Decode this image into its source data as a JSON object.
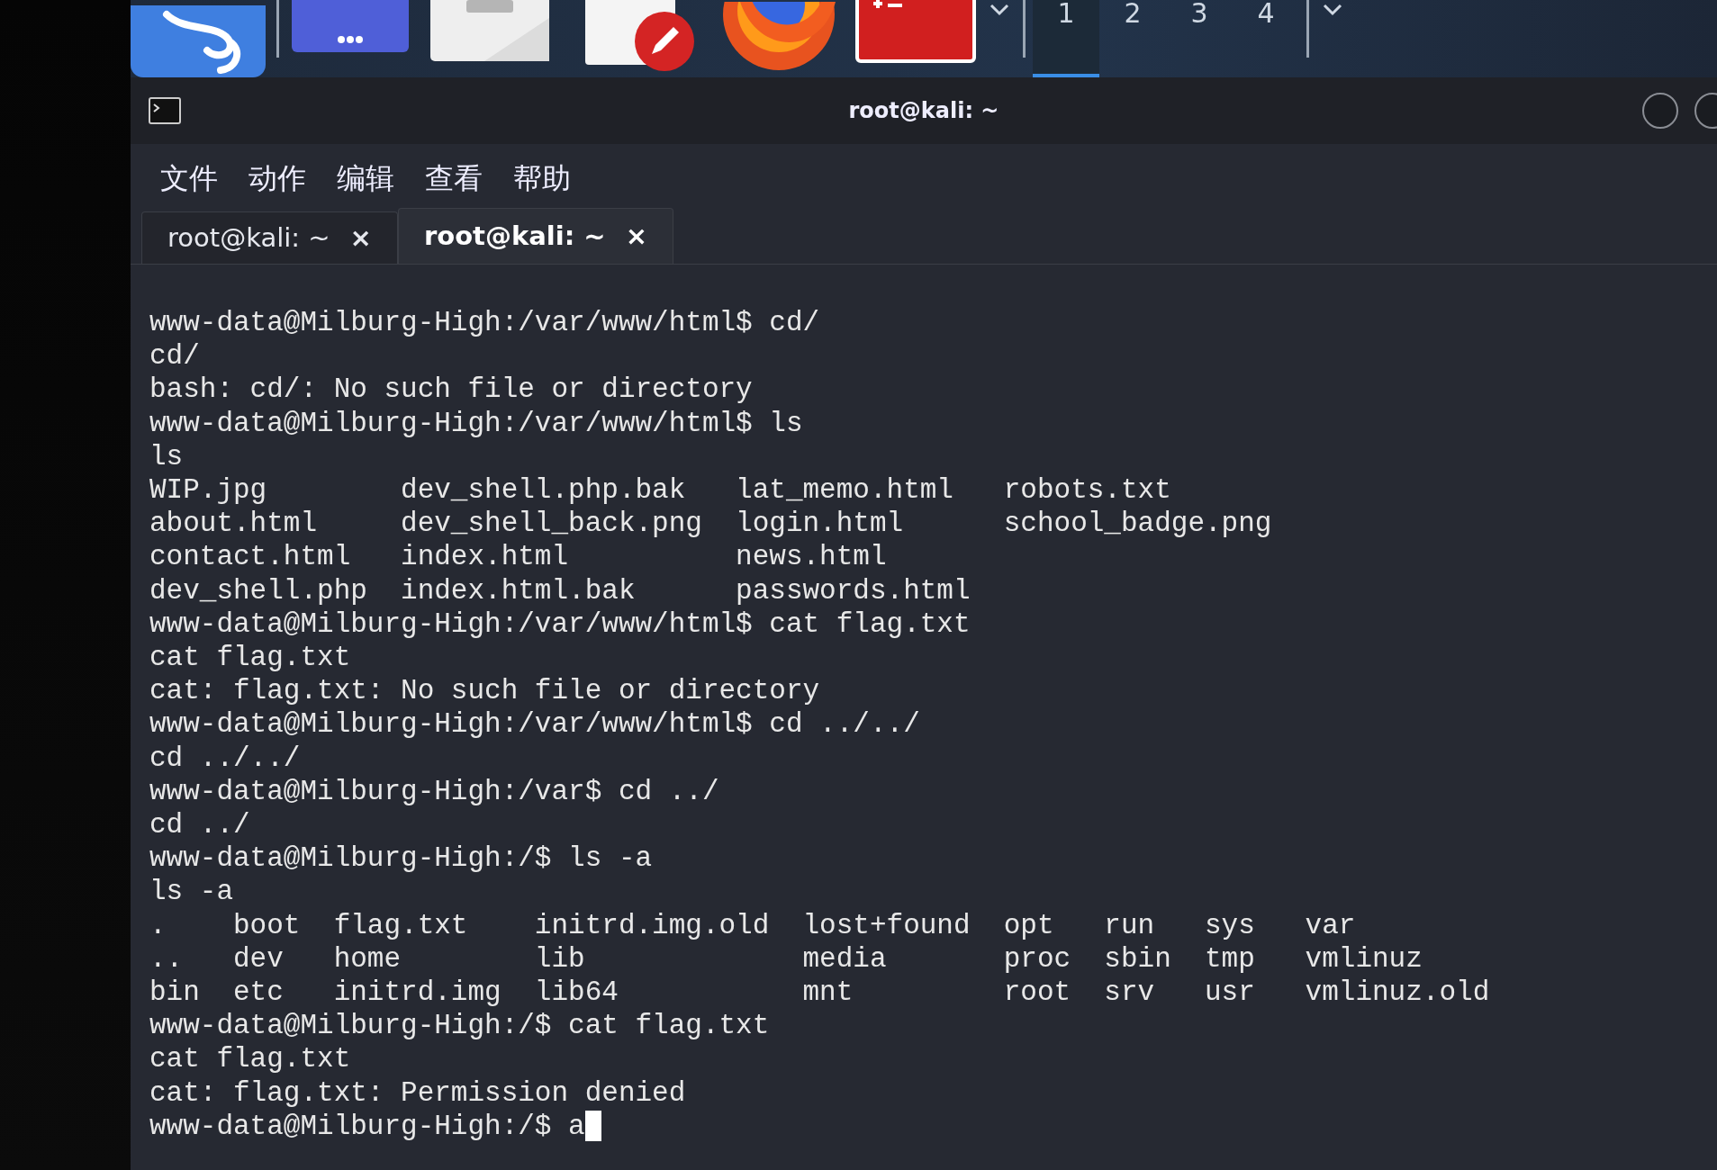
{
  "taskbar": {
    "workspaces": [
      {
        "label": "1",
        "selected": true
      },
      {
        "label": "2",
        "selected": false
      },
      {
        "label": "3",
        "selected": false
      },
      {
        "label": "4",
        "selected": false
      }
    ]
  },
  "window": {
    "title": "root@kali: ~"
  },
  "menu": [
    "文件",
    "动作",
    "编辑",
    "查看",
    "帮助"
  ],
  "tabs": [
    {
      "label": "root@kali: ~",
      "close": "×",
      "selected": false
    },
    {
      "label": "root@kali: ~",
      "close": "×",
      "selected": true
    }
  ],
  "terminal": {
    "lines": [
      "www-data@Milburg-High:/var/www/html$ cd/",
      "cd/",
      "bash: cd/: No such file or directory",
      "www-data@Milburg-High:/var/www/html$ ls",
      "ls",
      "WIP.jpg        dev_shell.php.bak   lat_memo.html   robots.txt",
      "about.html     dev_shell_back.png  login.html      school_badge.png",
      "contact.html   index.html          news.html",
      "dev_shell.php  index.html.bak      passwords.html",
      "www-data@Milburg-High:/var/www/html$ cat flag.txt",
      "cat flag.txt",
      "cat: flag.txt: No such file or directory",
      "www-data@Milburg-High:/var/www/html$ cd ../../",
      "cd ../../",
      "www-data@Milburg-High:/var$ cd ../",
      "cd ../",
      "www-data@Milburg-High:/$ ls -a",
      "ls -a",
      ".    boot  flag.txt    initrd.img.old  lost+found  opt   run   sys   var",
      "..   dev   home        lib             media       proc  sbin  tmp   vmlinuz",
      "bin  etc   initrd.img  lib64           mnt         root  srv   usr   vmlinuz.old",
      "www-data@Milburg-High:/$ cat flag.txt",
      "cat flag.txt",
      "cat: flag.txt: Permission denied",
      "www-data@Milburg-High:/$ a"
    ]
  }
}
